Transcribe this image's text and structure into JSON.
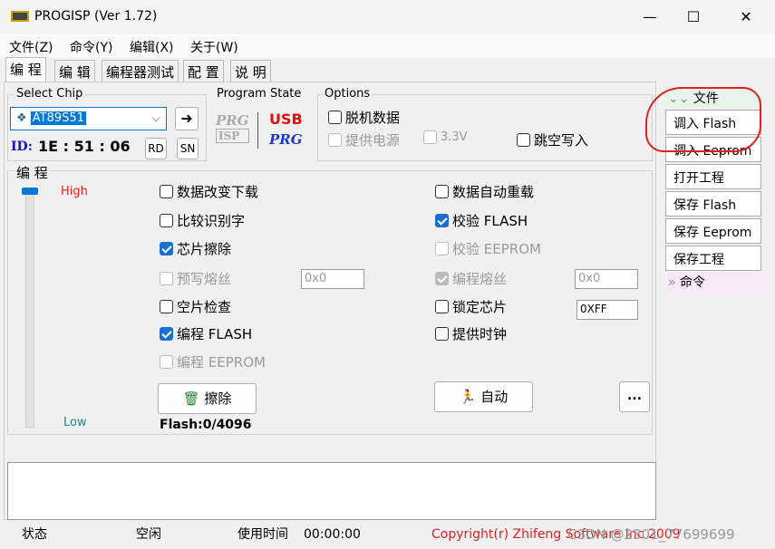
{
  "window": {
    "title": "PROGISP (Ver 1.72)",
    "minimize": "—",
    "maximize": "☐",
    "close": "✕"
  },
  "menu": [
    "文件(Z)",
    "命令(Y)",
    "编辑(X)",
    "关于(W)"
  ],
  "tabs": [
    "编 程",
    "编 辑",
    "编程器测试",
    "配 置",
    "说 明"
  ],
  "select_chip": {
    "label": "Select Chip",
    "value": "AT89S51",
    "id_label": "ID:",
    "id_value": "1E : 51 : 06",
    "rd": "RD",
    "sn": "SN",
    "go": "➜"
  },
  "program_state": {
    "label": "Program State",
    "prg": "PRG",
    "isp": "ISP",
    "usb": "USB",
    "usb_prg": "PRG"
  },
  "options": {
    "label": "Options",
    "offline": "脱机数据",
    "power": "提供电源",
    "v33": "3.3V",
    "skip": "跳空写入",
    "offline_checked": false,
    "power_checked": false,
    "v33_checked": false,
    "skip_checked": false
  },
  "program": {
    "label": "编 程",
    "high": "High",
    "low": "Low",
    "left": [
      {
        "label": "数据改变下载",
        "checked": false,
        "disabled": false
      },
      {
        "label": "比较识别字",
        "checked": false,
        "disabled": false
      },
      {
        "label": "芯片擦除",
        "checked": true,
        "disabled": false
      },
      {
        "label": "预写熔丝",
        "checked": false,
        "disabled": true
      },
      {
        "label": "空片检查",
        "checked": false,
        "disabled": false
      },
      {
        "label": "编程 FLASH",
        "checked": true,
        "disabled": false
      },
      {
        "label": "编程 EEPROM",
        "checked": false,
        "disabled": true
      }
    ],
    "right": [
      {
        "label": "数据自动重载",
        "checked": false,
        "disabled": false
      },
      {
        "label": "校验 FLASH",
        "checked": true,
        "disabled": false
      },
      {
        "label": "校验 EEPROM",
        "checked": false,
        "disabled": true
      },
      {
        "label": "编程熔丝",
        "checked": true,
        "disabled": true
      },
      {
        "label": "锁定芯片",
        "checked": false,
        "disabled": false
      },
      {
        "label": "提供时钟",
        "checked": false,
        "disabled": false
      }
    ],
    "fuse_pre": "0x0",
    "fuse_prog": "0x0",
    "lock": "0XFF",
    "erase": "擦除",
    "auto": "自动",
    "more": "...",
    "flash": "Flash:0/4096"
  },
  "sidebar": {
    "file_header": "文件",
    "cmd_header": "命令",
    "items": [
      "调入 Flash",
      "调入 Eeprom",
      "打开工程",
      "保存 Flash",
      "保存 Eeprom",
      "保存工程"
    ]
  },
  "status": {
    "label": "状态",
    "value": "空闲",
    "time_label": "使用时间",
    "time": "00:00:00",
    "copyright": "Copyright(r) Zhifeng Software Inc 2009",
    "watermark": "CSDN @2301_77699699"
  }
}
